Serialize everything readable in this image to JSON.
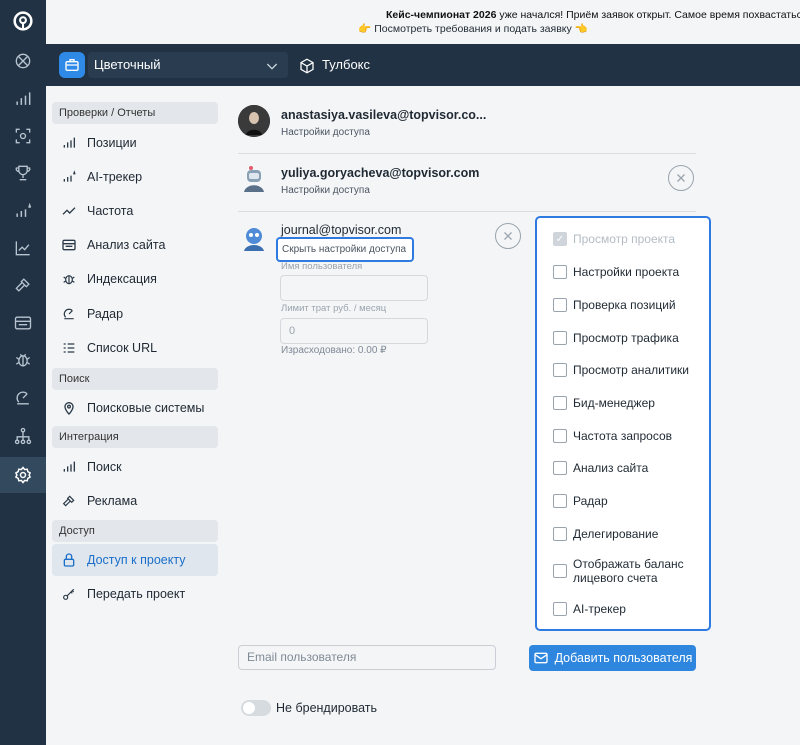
{
  "banner": {
    "bold": "Кейс-чемпионат 2026",
    "text": " уже начался! Приём заявок открыт. Самое время похвастаться лучш",
    "link": "👉 Посмотреть требования и подать заявку 👈"
  },
  "project_bar": {
    "project_name": "Цветочный",
    "toolbox_label": "Тулбокс"
  },
  "sidebar": {
    "sections": [
      {
        "title": "Проверки / Отчеты",
        "items": [
          {
            "label": "Позиции",
            "icon": "bar-chart-icon"
          },
          {
            "label": "AI-трекер",
            "icon": "ai-chart-icon"
          },
          {
            "label": "Частота",
            "icon": "trend-icon"
          },
          {
            "label": "Анализ сайта",
            "icon": "site-audit-icon"
          },
          {
            "label": "Индексация",
            "icon": "bug-icon"
          },
          {
            "label": "Радар",
            "icon": "radar-icon"
          },
          {
            "label": "Список URL",
            "icon": "list-icon"
          }
        ]
      },
      {
        "title": "Поиск",
        "items": [
          {
            "label": "Поисковые системы",
            "icon": "location-pin-icon"
          }
        ]
      },
      {
        "title": "Интеграция",
        "items": [
          {
            "label": "Поиск",
            "icon": "bar-chart-icon"
          },
          {
            "label": "Реклама",
            "icon": "hammer-icon"
          }
        ]
      },
      {
        "title": "Доступ",
        "items": [
          {
            "label": "Доступ к проекту",
            "icon": "lock-icon",
            "active": true
          },
          {
            "label": "Передать проект",
            "icon": "key-icon"
          }
        ]
      }
    ]
  },
  "users": [
    {
      "email": "anastasiya.vasileva@topvisor.co...",
      "sub": "Настройки доступа"
    },
    {
      "email": "yuliya.goryacheva@topvisor.com",
      "sub": "Настройки доступа"
    },
    {
      "email": "journal@topvisor.com",
      "sub": "Скрыть настройки доступа"
    }
  ],
  "access_form": {
    "username_label": "Имя пользователя",
    "username_value": "",
    "limit_label": "Лимит трат руб. / месяц",
    "limit_value": "0",
    "spent_text": "Израсходовано: 0.00 ₽"
  },
  "permissions": [
    {
      "label": "Просмотр проекта",
      "checked": true,
      "disabled": true
    },
    {
      "label": "Настройки проекта",
      "checked": false
    },
    {
      "label": "Проверка позиций",
      "checked": false
    },
    {
      "label": "Просмотр трафика",
      "checked": false
    },
    {
      "label": "Просмотр аналитики",
      "checked": false
    },
    {
      "label": "Бид-менеджер",
      "checked": false
    },
    {
      "label": "Частота запросов",
      "checked": false
    },
    {
      "label": "Анализ сайта",
      "checked": false
    },
    {
      "label": "Радар",
      "checked": false
    },
    {
      "label": "Делегирование",
      "checked": false
    },
    {
      "label": "Отображать баланс лицевого счета",
      "checked": false
    },
    {
      "label": "AI-трекер",
      "checked": false
    }
  ],
  "add_user": {
    "email_placeholder": "Email пользователя",
    "button_label": "Добавить пользователя"
  },
  "branding": {
    "toggle_label": "Не брендировать",
    "enabled": false
  },
  "colors": {
    "accent": "#2e86de",
    "rail": "#203243",
    "highlight_border": "#2e7ae0"
  }
}
